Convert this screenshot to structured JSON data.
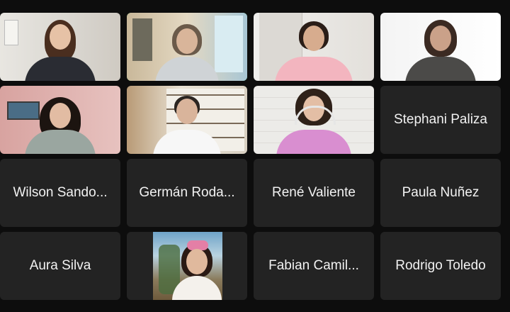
{
  "meeting": {
    "participants_with_names": [
      {
        "id": "stephani",
        "label": "Stephani Paliza"
      },
      {
        "id": "wilson",
        "label": "Wilson Sando..."
      },
      {
        "id": "german",
        "label": "Germán Roda..."
      },
      {
        "id": "rene",
        "label": "René Valiente"
      },
      {
        "id": "paula",
        "label": "Paula Nuñez"
      },
      {
        "id": "aura",
        "label": "Aura Silva"
      },
      {
        "id": "fabian",
        "label": "Fabian Camil..."
      },
      {
        "id": "rodrigo",
        "label": "Rodrigo Toledo"
      }
    ],
    "active_speaker_color": "#23d959",
    "tile_color": "#232323"
  }
}
